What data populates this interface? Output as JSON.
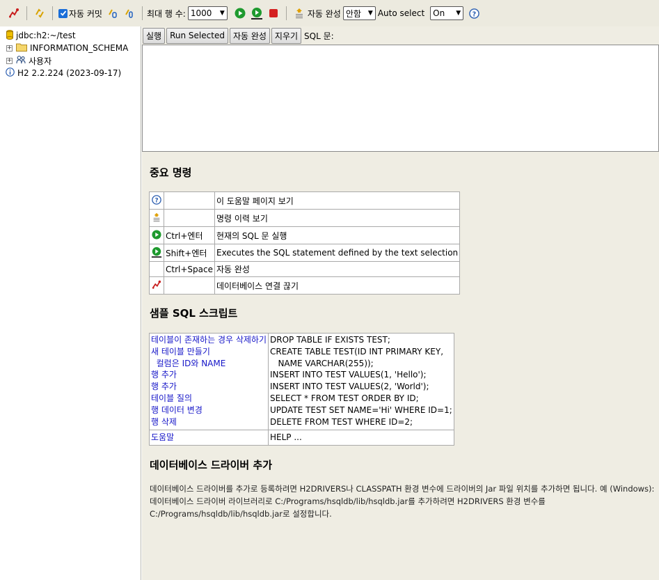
{
  "toolbar": {
    "autocommit_label": "자동 커밋",
    "autocommit_checked": true,
    "max_rows_label": "최대 행 수:",
    "max_rows_value": "1000",
    "autocomplete_label": "자동 완성",
    "autocomplete_value": "안함",
    "autoselect_label": "Auto select",
    "autoselect_value": "On"
  },
  "tree": {
    "connection": "jdbc:h2:~/test",
    "items": [
      {
        "label": "INFORMATION_SCHEMA",
        "icon": "folder-icon"
      },
      {
        "label": "사용자",
        "icon": "users-icon"
      }
    ],
    "version": "H2 2.2.224 (2023-09-17)"
  },
  "commands": {
    "run": "실행",
    "run_selected": "Run Selected",
    "autocomplete": "자동 완성",
    "clear": "지우기",
    "sql_label": "SQL 문:"
  },
  "important": {
    "title": "중요 명령",
    "rows": [
      {
        "icon": "help-icon",
        "key": "",
        "desc": "이 도움말 페이지 보기"
      },
      {
        "icon": "history-icon",
        "key": "",
        "desc": "명령 이력 보기"
      },
      {
        "icon": "run-icon",
        "key": "Ctrl+엔터",
        "desc": "현재의 SQL 문 실행"
      },
      {
        "icon": "run-selected-icon",
        "key": "Shift+엔터",
        "desc": "Executes the SQL statement defined by the text selection"
      },
      {
        "icon": "",
        "key": "Ctrl+Space",
        "desc": "자동 완성"
      },
      {
        "icon": "disconnect-icon",
        "key": "",
        "desc": "데이터베이스 연결 끊기"
      }
    ]
  },
  "sample": {
    "title": "샘플 SQL 스크립트",
    "links": [
      "테이블이 존재하는 경우 삭제하기",
      "새 테이블 만들기",
      "  컬럼은 ID와 NAME",
      "행 추가",
      "행 추가",
      "테이블 질의",
      "행 데이터 변경",
      "행 삭제"
    ],
    "sql": [
      "DROP TABLE IF EXISTS TEST;",
      "CREATE TABLE TEST(ID INT PRIMARY KEY,",
      "   NAME VARCHAR(255));",
      "INSERT INTO TEST VALUES(1, 'Hello');",
      "INSERT INTO TEST VALUES(2, 'World');",
      "SELECT * FROM TEST ORDER BY ID;",
      "UPDATE TEST SET NAME='Hi' WHERE ID=1;",
      "DELETE FROM TEST WHERE ID=2;"
    ],
    "help_link": "도움말",
    "help_sql": "HELP ..."
  },
  "driver": {
    "title": "데이터베이스 드라이버 추가",
    "text": "데이터베이스 드라이버를 추가로 등록하려면 H2DRIVERS나 CLASSPATH 환경 변수에 드라이버의 Jar 파일 위치를 추가하면 됩니다. 예 (Windows): 데이터베이스 드라이버 라이브러리로 C:/Programs/hsqldb/lib/hsqldb.jar를 추가하려면 H2DRIVERS 환경 변수를 C:/Programs/hsqldb/lib/hsqldb.jar로 설정합니다."
  },
  "colors": {
    "toolbar_bg": "#eceadf",
    "panel_bg": "#efede3",
    "link": "#1515c8",
    "run_green": "#1e9a2e",
    "stop_red": "#d42020"
  }
}
